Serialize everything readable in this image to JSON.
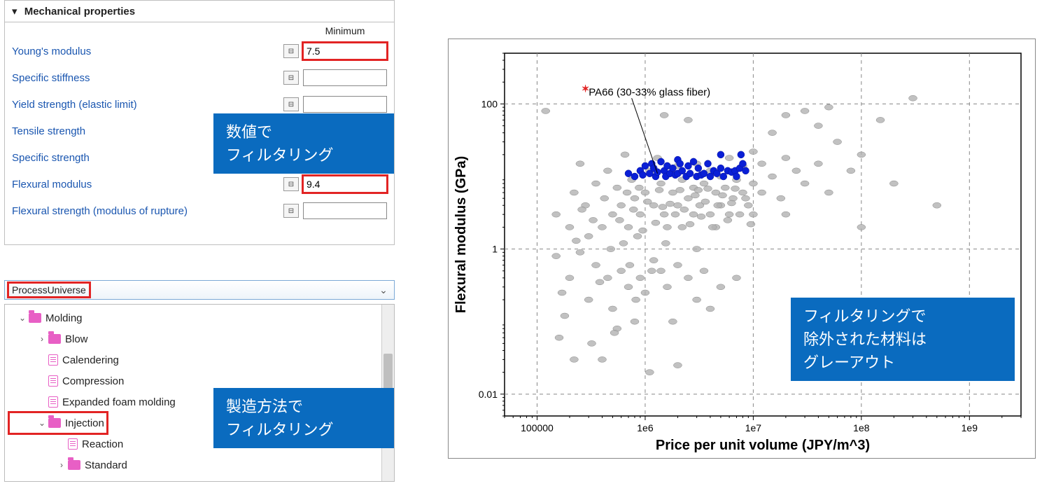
{
  "mech_panel": {
    "title": "Mechanical properties",
    "min_header": "Minimum",
    "properties": [
      {
        "name": "Young's modulus",
        "has_icon": true,
        "value": "7.5",
        "highlight": true
      },
      {
        "name": "Specific stiffness",
        "has_icon": true,
        "value": "",
        "highlight": false
      },
      {
        "name": "Yield strength (elastic limit)",
        "has_icon": true,
        "value": "",
        "highlight": false
      },
      {
        "name": "Tensile strength",
        "has_icon": true,
        "value": "",
        "highlight": false
      },
      {
        "name": "Specific strength",
        "has_icon": true,
        "value": "",
        "highlight": false
      },
      {
        "name": "Flexural modulus",
        "has_icon": true,
        "value": "9.4",
        "highlight": true
      },
      {
        "name": "Flexural strength (modulus of rupture)",
        "has_icon": true,
        "value": "",
        "highlight": false
      }
    ]
  },
  "process_panel": {
    "combo_label": "ProcessUniverse",
    "tree": [
      {
        "indent": 0,
        "twisty": "v",
        "icon": "folder",
        "label": "Molding",
        "highlight": false
      },
      {
        "indent": 1,
        "twisty": ">",
        "icon": "folder",
        "label": "Blow",
        "highlight": false
      },
      {
        "indent": 1,
        "twisty": "",
        "icon": "file",
        "label": "Calendering",
        "highlight": false
      },
      {
        "indent": 1,
        "twisty": "",
        "icon": "file",
        "label": "Compression",
        "highlight": false
      },
      {
        "indent": 1,
        "twisty": "",
        "icon": "file",
        "label": "Expanded foam molding",
        "highlight": false
      },
      {
        "indent": 1,
        "twisty": "v",
        "icon": "folder",
        "label": "Injection",
        "highlight": true
      },
      {
        "indent": 2,
        "twisty": "",
        "icon": "file",
        "label": "Reaction",
        "highlight": false
      },
      {
        "indent": 2,
        "twisty": ">",
        "icon": "folder",
        "label": "Standard",
        "highlight": false
      }
    ]
  },
  "callouts": {
    "c1_line1": "数値で",
    "c1_line2": "フィルタリング",
    "c2_line1": "製造方法で",
    "c2_line2": "フィルタリング",
    "c3_line1": "フィルタリングで",
    "c3_line2": "除外された材料は",
    "c3_line3": "グレーアウト"
  },
  "chart_data": {
    "type": "scatter",
    "title": "",
    "xlabel": "Price per unit volume (JPY/m^3)",
    "ylabel": "Flexural modulus (GPa)",
    "x_scale": "log",
    "y_scale": "log",
    "x_ticks": [
      100000,
      1000000.0,
      10000000.0,
      100000000.0,
      1000000000.0
    ],
    "x_tick_labels": [
      "100000",
      "1e6",
      "1e7",
      "1e8",
      "1e9"
    ],
    "y_ticks": [
      0.01,
      1,
      100
    ],
    "y_tick_labels": [
      "0.01",
      "1",
      "100"
    ],
    "xlim": [
      50000,
      3000000000.0
    ],
    "ylim": [
      0.005,
      500
    ],
    "annotation": {
      "text": "PA66 (30-33% glass fiber)",
      "x": 350000.0,
      "y": 9
    },
    "annotation_marker": {
      "x": 280000.0,
      "y": 160,
      "symbol": "star",
      "color": "#e22424"
    },
    "series": [
      {
        "name": "filtered-out",
        "color": "#b2b2b2",
        "points": [
          {
            "x": 120000.0,
            "y": 80
          },
          {
            "x": 150000.0,
            "y": 3
          },
          {
            "x": 150000.0,
            "y": 0.8
          },
          {
            "x": 160000.0,
            "y": 0.06
          },
          {
            "x": 180000.0,
            "y": 0.12
          },
          {
            "x": 200000.0,
            "y": 2
          },
          {
            "x": 200000.0,
            "y": 0.4
          },
          {
            "x": 220000.0,
            "y": 6
          },
          {
            "x": 220000.0,
            "y": 0.03
          },
          {
            "x": 250000.0,
            "y": 0.9
          },
          {
            "x": 250000.0,
            "y": 15
          },
          {
            "x": 280000.0,
            "y": 4
          },
          {
            "x": 300000.0,
            "y": 1.5
          },
          {
            "x": 300000.0,
            "y": 0.2
          },
          {
            "x": 320000.0,
            "y": 0.05
          },
          {
            "x": 350000.0,
            "y": 8
          },
          {
            "x": 350000.0,
            "y": 0.6
          },
          {
            "x": 400000.0,
            "y": 2
          },
          {
            "x": 400000.0,
            "y": 0.03
          },
          {
            "x": 450000.0,
            "y": 12
          },
          {
            "x": 450000.0,
            "y": 0.4
          },
          {
            "x": 500000.0,
            "y": 3
          },
          {
            "x": 500000.0,
            "y": 0.15
          },
          {
            "x": 550000.0,
            "y": 7
          },
          {
            "x": 550000.0,
            "y": 0.08
          },
          {
            "x": 600000.0,
            "y": 4
          },
          {
            "x": 600000.0,
            "y": 0.5
          },
          {
            "x": 650000.0,
            "y": 20
          },
          {
            "x": 700000.0,
            "y": 2
          },
          {
            "x": 700000.0,
            "y": 0.3
          },
          {
            "x": 750000.0,
            "y": 9
          },
          {
            "x": 800000.0,
            "y": 5
          },
          {
            "x": 800000.0,
            "y": 0.1
          },
          {
            "x": 850000.0,
            "y": 1.5
          },
          {
            "x": 900000.0,
            "y": 3
          },
          {
            "x": 900000.0,
            "y": 0.4
          },
          {
            "x": 1000000.0,
            "y": 6
          },
          {
            "x": 1000000.0,
            "y": 0.25
          },
          {
            "x": 1100000.0,
            "y": 12
          },
          {
            "x": 1100000.0,
            "y": 0.02
          },
          {
            "x": 1200000.0,
            "y": 4
          },
          {
            "x": 1200000.0,
            "y": 0.7
          },
          {
            "x": 1300000.0,
            "y": 18
          },
          {
            "x": 1400000.0,
            "y": 8
          },
          {
            "x": 1400000.0,
            "y": 0.5
          },
          {
            "x": 1500000.0,
            "y": 3
          },
          {
            "x": 1500000.0,
            "y": 70
          },
          {
            "x": 1600000.0,
            "y": 2
          },
          {
            "x": 1600000.0,
            "y": 0.3
          },
          {
            "x": 1800000.0,
            "y": 6
          },
          {
            "x": 1800000.0,
            "y": 0.1
          },
          {
            "x": 2000000.0,
            "y": 4
          },
          {
            "x": 2000000.0,
            "y": 14
          },
          {
            "x": 2000000.0,
            "y": 0.6
          },
          {
            "x": 2000000.0,
            "y": 0.025
          },
          {
            "x": 2200000.0,
            "y": 9
          },
          {
            "x": 2200000.0,
            "y": 2
          },
          {
            "x": 2500000.0,
            "y": 5
          },
          {
            "x": 2500000.0,
            "y": 0.4
          },
          {
            "x": 2500000.0,
            "y": 60
          },
          {
            "x": 2800000.0,
            "y": 7
          },
          {
            "x": 2800000.0,
            "y": 3
          },
          {
            "x": 3000000.0,
            "y": 15
          },
          {
            "x": 3000000.0,
            "y": 1
          },
          {
            "x": 3000000.0,
            "y": 0.2
          },
          {
            "x": 3200000.0,
            "y": 4
          },
          {
            "x": 3500000.0,
            "y": 8
          },
          {
            "x": 3500000.0,
            "y": 0.5
          },
          {
            "x": 4000000.0,
            "y": 12
          },
          {
            "x": 4000000.0,
            "y": 3
          },
          {
            "x": 4000000.0,
            "y": 0.15
          },
          {
            "x": 4500000.0,
            "y": 6
          },
          {
            "x": 4500000.0,
            "y": 2
          },
          {
            "x": 5000000.0,
            "y": 10
          },
          {
            "x": 5000000.0,
            "y": 4
          },
          {
            "x": 5000000.0,
            "y": 0.3
          },
          {
            "x": 5500000.0,
            "y": 7
          },
          {
            "x": 6000000.0,
            "y": 18
          },
          {
            "x": 6000000.0,
            "y": 3
          },
          {
            "x": 6500000.0,
            "y": 5
          },
          {
            "x": 7000000.0,
            "y": 9
          },
          {
            "x": 7000000.0,
            "y": 0.4
          },
          {
            "x": 8000000.0,
            "y": 6
          },
          {
            "x": 8000000.0,
            "y": 14
          },
          {
            "x": 9000000.0,
            "y": 4
          },
          {
            "x": 10000000.0,
            "y": 8
          },
          {
            "x": 10000000.0,
            "y": 22
          },
          {
            "x": 10000000.0,
            "y": 3
          },
          {
            "x": 12000000.0,
            "y": 6
          },
          {
            "x": 12000000.0,
            "y": 15
          },
          {
            "x": 15000000.0,
            "y": 10
          },
          {
            "x": 15000000.0,
            "y": 40
          },
          {
            "x": 18000000.0,
            "y": 5
          },
          {
            "x": 20000000.0,
            "y": 18
          },
          {
            "x": 20000000.0,
            "y": 70
          },
          {
            "x": 20000000.0,
            "y": 3
          },
          {
            "x": 25000000.0,
            "y": 12
          },
          {
            "x": 30000000.0,
            "y": 80
          },
          {
            "x": 30000000.0,
            "y": 8
          },
          {
            "x": 35000000.0,
            "y": 0.06
          },
          {
            "x": 40000000.0,
            "y": 15
          },
          {
            "x": 40000000.0,
            "y": 50
          },
          {
            "x": 50000000.0,
            "y": 90
          },
          {
            "x": 50000000.0,
            "y": 6
          },
          {
            "x": 60000000.0,
            "y": 30
          },
          {
            "x": 80000000.0,
            "y": 12
          },
          {
            "x": 100000000.0,
            "y": 20
          },
          {
            "x": 100000000.0,
            "y": 2
          },
          {
            "x": 150000000.0,
            "y": 60
          },
          {
            "x": 200000000.0,
            "y": 8
          },
          {
            "x": 300000000.0,
            "y": 120
          },
          {
            "x": 500000000.0,
            "y": 4
          },
          {
            "x": 170000.0,
            "y": 0.25
          },
          {
            "x": 230000.0,
            "y": 1.3
          },
          {
            "x": 260000.0,
            "y": 3.5
          },
          {
            "x": 330000.0,
            "y": 2.5
          },
          {
            "x": 380000.0,
            "y": 0.35
          },
          {
            "x": 420000.0,
            "y": 5
          },
          {
            "x": 480000.0,
            "y": 1.0
          },
          {
            "x": 520000.0,
            "y": 0.07
          },
          {
            "x": 580000.0,
            "y": 2.5
          },
          {
            "x": 630000.0,
            "y": 1.2
          },
          {
            "x": 680000.0,
            "y": 6
          },
          {
            "x": 720000.0,
            "y": 0.6
          },
          {
            "x": 780000.0,
            "y": 3.5
          },
          {
            "x": 820000.0,
            "y": 0.2
          },
          {
            "x": 880000.0,
            "y": 7
          },
          {
            "x": 950000.0,
            "y": 1.8
          },
          {
            "x": 1050000.0,
            "y": 4.5
          },
          {
            "x": 1150000.0,
            "y": 0.5
          },
          {
            "x": 1250000.0,
            "y": 2.3
          },
          {
            "x": 1350000.0,
            "y": 6.5
          },
          {
            "x": 1450000.0,
            "y": 3.8
          },
          {
            "x": 1550000.0,
            "y": 1.2
          },
          {
            "x": 1700000.0,
            "y": 4.2
          },
          {
            "x": 1900000.0,
            "y": 3
          },
          {
            "x": 2100000.0,
            "y": 6.5
          },
          {
            "x": 2300000.0,
            "y": 3.5
          },
          {
            "x": 2600000.0,
            "y": 2.2
          },
          {
            "x": 2900000.0,
            "y": 5.5
          },
          {
            "x": 3100000.0,
            "y": 6.5
          },
          {
            "x": 3300000.0,
            "y": 2.8
          },
          {
            "x": 3600000.0,
            "y": 4.5
          },
          {
            "x": 3800000.0,
            "y": 6.8
          },
          {
            "x": 4200000.0,
            "y": 2
          },
          {
            "x": 4700000.0,
            "y": 4
          },
          {
            "x": 5200000.0,
            "y": 5.5
          },
          {
            "x": 5800000.0,
            "y": 2.5
          },
          {
            "x": 6300000.0,
            "y": 4.3
          },
          {
            "x": 6800000.0,
            "y": 6.8
          },
          {
            "x": 7500000.0,
            "y": 3
          },
          {
            "x": 8500000.0,
            "y": 5
          },
          {
            "x": 9500000.0,
            "y": 2.2
          }
        ]
      },
      {
        "name": "passing",
        "color": "#0a1fd6",
        "points": [
          {
            "x": 700000.0,
            "y": 11
          },
          {
            "x": 800000.0,
            "y": 10
          },
          {
            "x": 900000.0,
            "y": 12
          },
          {
            "x": 950000.0,
            "y": 10.5
          },
          {
            "x": 1000000.0,
            "y": 14
          },
          {
            "x": 1100000.0,
            "y": 11
          },
          {
            "x": 1150000.0,
            "y": 15
          },
          {
            "x": 1200000.0,
            "y": 13
          },
          {
            "x": 1250000.0,
            "y": 10
          },
          {
            "x": 1300000.0,
            "y": 11.5
          },
          {
            "x": 1400000.0,
            "y": 16
          },
          {
            "x": 1500000.0,
            "y": 12
          },
          {
            "x": 1550000.0,
            "y": 10
          },
          {
            "x": 1600000.0,
            "y": 14
          },
          {
            "x": 1700000.0,
            "y": 11
          },
          {
            "x": 1800000.0,
            "y": 13
          },
          {
            "x": 1900000.0,
            "y": 10.5
          },
          {
            "x": 2000000.0,
            "y": 17
          },
          {
            "x": 2000000.0,
            "y": 11
          },
          {
            "x": 2100000.0,
            "y": 15
          },
          {
            "x": 2200000.0,
            "y": 12
          },
          {
            "x": 2400000.0,
            "y": 10
          },
          {
            "x": 2500000.0,
            "y": 14
          },
          {
            "x": 2600000.0,
            "y": 11
          },
          {
            "x": 2800000.0,
            "y": 16
          },
          {
            "x": 3000000.0,
            "y": 10
          },
          {
            "x": 3100000.0,
            "y": 13
          },
          {
            "x": 3300000.0,
            "y": 10.5
          },
          {
            "x": 3500000.0,
            "y": 11
          },
          {
            "x": 3800000.0,
            "y": 15
          },
          {
            "x": 4000000.0,
            "y": 10
          },
          {
            "x": 4300000.0,
            "y": 12
          },
          {
            "x": 4600000.0,
            "y": 11
          },
          {
            "x": 5000000.0,
            "y": 20
          },
          {
            "x": 5000000.0,
            "y": 13
          },
          {
            "x": 5300000.0,
            "y": 10
          },
          {
            "x": 5800000.0,
            "y": 12
          },
          {
            "x": 6300000.0,
            "y": 11.5
          },
          {
            "x": 6800000.0,
            "y": 12
          },
          {
            "x": 7000000.0,
            "y": 10
          },
          {
            "x": 7500000.0,
            "y": 13
          },
          {
            "x": 7700000.0,
            "y": 20
          },
          {
            "x": 8000000.0,
            "y": 15
          },
          {
            "x": 8500000.0,
            "y": 12
          }
        ]
      }
    ]
  }
}
